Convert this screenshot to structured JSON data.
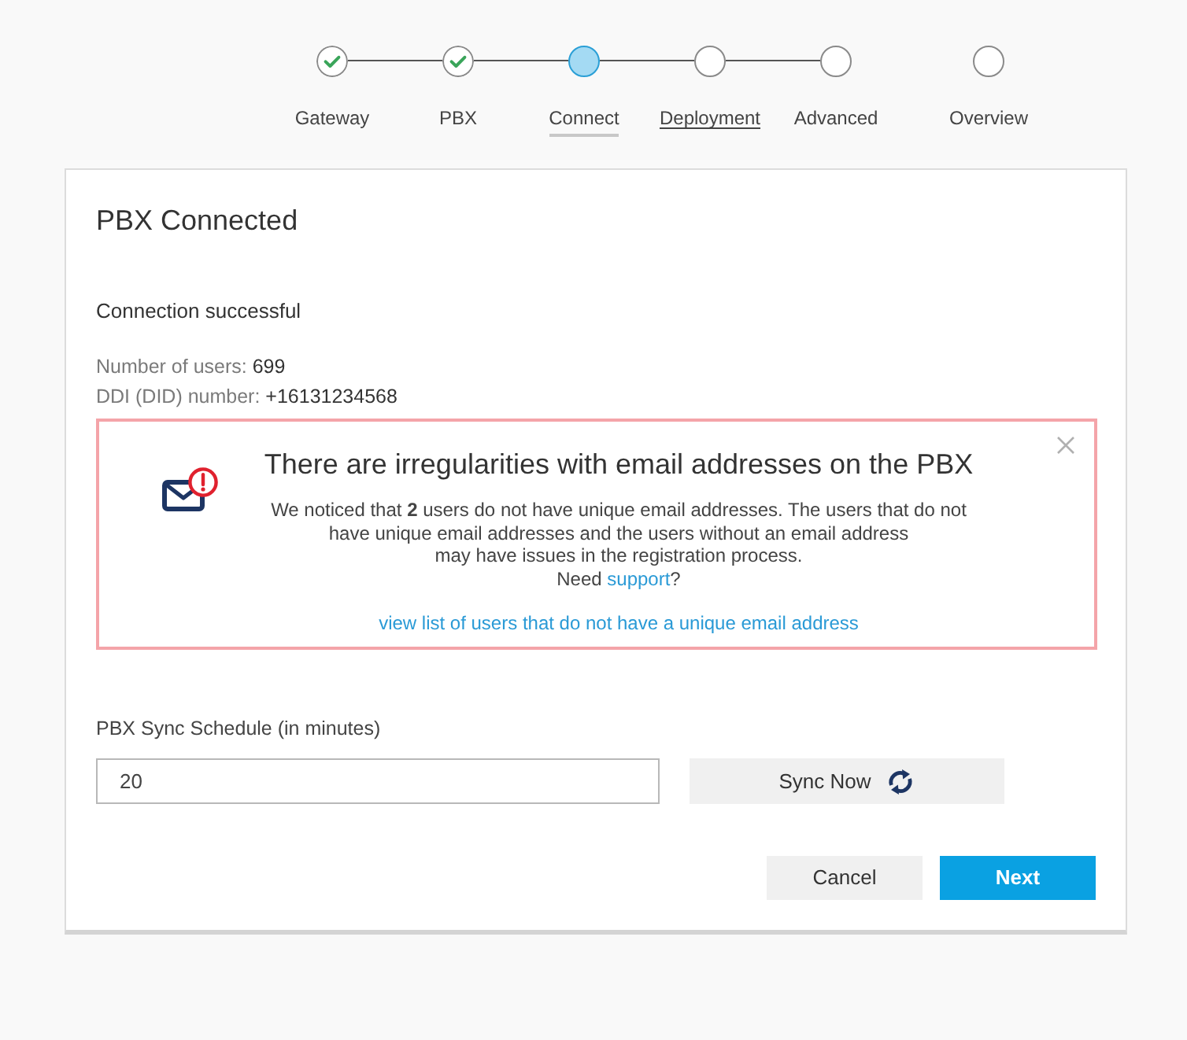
{
  "stepper": {
    "steps": [
      {
        "label": "Gateway",
        "completed": true,
        "selected": false,
        "underlined": false,
        "connector": true
      },
      {
        "label": "PBX",
        "completed": true,
        "selected": false,
        "underlined": false,
        "connector": true
      },
      {
        "label": "Connect",
        "completed": false,
        "selected": true,
        "underlined": false,
        "connector": true
      },
      {
        "label": "Deployment",
        "completed": false,
        "selected": false,
        "underlined": true,
        "connector": true
      },
      {
        "label": "Advanced",
        "completed": false,
        "selected": false,
        "underlined": false,
        "connector": false
      },
      {
        "label": "Overview",
        "completed": false,
        "selected": false,
        "underlined": false,
        "connector": false
      }
    ]
  },
  "card": {
    "title": "PBX Connected",
    "status_text": "Connection successful",
    "details": [
      {
        "label": "Number of users:",
        "value": "699"
      },
      {
        "label": "DDI (DID) number:",
        "value": "+16131234568"
      }
    ],
    "alert": {
      "title": "There are irregularities with email addresses on the PBX",
      "body_lines": [
        "We noticed that **2** users do not have unique email addresses. The users that do not",
        "have unique email addresses and the users without an email address",
        "may have issues in the registration process."
      ],
      "support_prefix": "Need",
      "support_link": "support",
      "support_suffix": "?",
      "list_link": "view list of users that do not have a unique email address"
    },
    "sync": {
      "label": "PBX Sync Schedule (in minutes)",
      "value": "20",
      "button": "Sync Now"
    },
    "buttons": [
      {
        "label": "Cancel",
        "kind": "secondary"
      },
      {
        "label": "Next",
        "kind": "primary"
      }
    ]
  }
}
